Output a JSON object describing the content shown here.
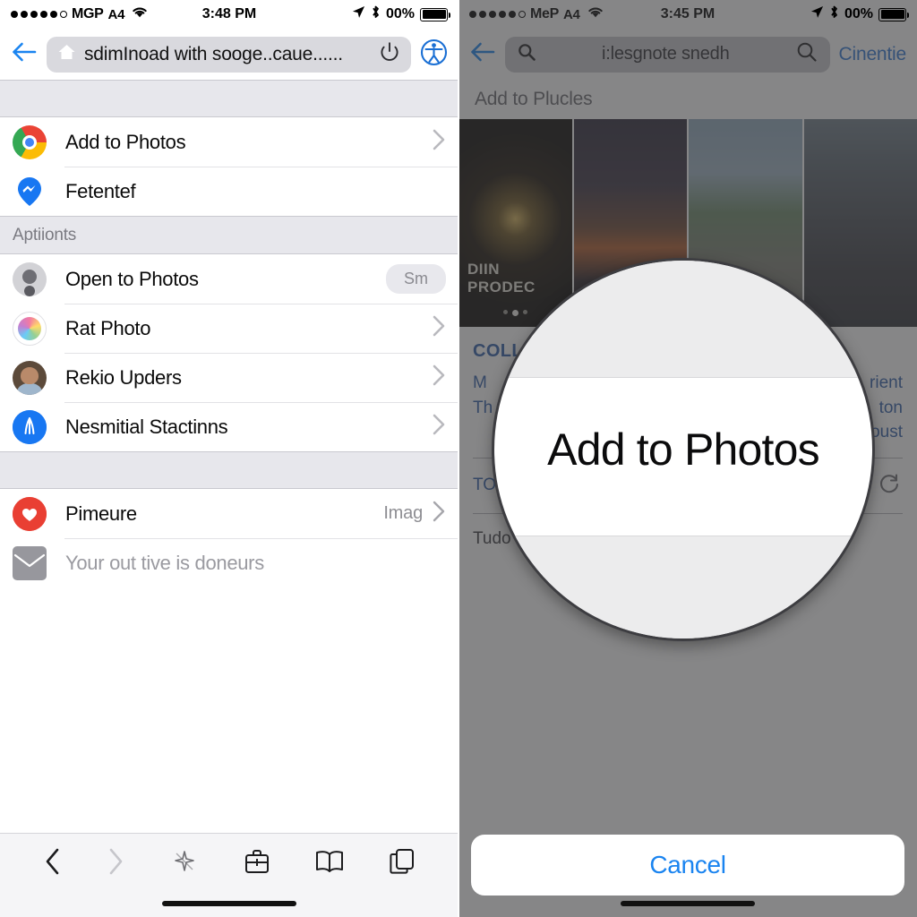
{
  "left": {
    "status": {
      "signal_filled": 5,
      "signal_empty": 1,
      "carrier": "MGP",
      "network": "A4",
      "wifi_icon": "wifi-icon",
      "time": "3:48 PM",
      "location_icon": "location-arrow-icon",
      "bluetooth_icon": "bluetooth-icon",
      "battery_percent": "00%"
    },
    "topbar": {
      "back_icon": "back-arrow-icon",
      "home_icon": "home-icon",
      "url": "sdimInoad with sooge..caue......",
      "reload_icon": "power-reload-icon",
      "extension_icon": "accessibility-icon"
    },
    "sections": [
      {
        "type": "rows",
        "items": [
          {
            "icon": "chrome-icon",
            "label": "Add to Photos",
            "accessory": "chevron"
          },
          {
            "icon": "messenger-pin-icon",
            "label": "Fetentef",
            "accessory": "none"
          }
        ]
      },
      {
        "type": "header",
        "title": "Aptiionts"
      },
      {
        "type": "rows",
        "items": [
          {
            "icon": "person-gray-icon",
            "label": "Open to Photos",
            "accessory": "pill",
            "pill": "Sm"
          },
          {
            "icon": "colorful-ring-icon",
            "label": "Rat Photo",
            "accessory": "chevron"
          },
          {
            "icon": "contact-avatar-icon",
            "label": "Rekio Upders",
            "accessory": "chevron"
          },
          {
            "icon": "blue-circle-icon",
            "label": "Nesmitial Stactinns",
            "accessory": "chevron"
          }
        ]
      },
      {
        "type": "spacer"
      },
      {
        "type": "rows",
        "items": [
          {
            "icon": "heart-red-icon",
            "label": "Pimeure",
            "accessory": "chevron",
            "aux": "Imag"
          },
          {
            "icon": "envelope-gray-icon",
            "label": "Your out tive is doneurs",
            "accessory": "none",
            "muted": true
          }
        ]
      }
    ],
    "toolbar": {
      "back_icon": "chevron-left-icon",
      "forward_icon": "chevron-right-icon",
      "share_icon": "share-sparkle-icon",
      "briefcase_icon": "briefcase-icon",
      "book_icon": "book-icon",
      "tabs_icon": "tabs-icon"
    }
  },
  "right": {
    "status": {
      "signal_filled": 5,
      "signal_empty": 1,
      "carrier": "MeP",
      "network": "A4",
      "wifi_icon": "wifi-icon",
      "time": "3:45 PM",
      "location_icon": "location-arrow-icon",
      "bluetooth_icon": "bluetooth-icon",
      "battery_percent": "00%"
    },
    "topbar": {
      "back_icon": "back-arrow-icon",
      "search_icon": "search-icon",
      "search_value": "i:lesgnote snedh",
      "search_submit_icon": "search-submit-icon",
      "link_label": "Cinentie"
    },
    "section_title": "Add to Plucles",
    "thumbnails": [
      {
        "caption": "DIIN PRODEC",
        "dots": 3,
        "active_dot": 2
      },
      {
        "caption": "",
        "dots": 0,
        "active_dot": 0
      },
      {
        "caption": "",
        "dots": 0,
        "active_dot": 0
      },
      {
        "caption": "",
        "dots": 0,
        "active_dot": 0
      }
    ],
    "body": {
      "heading": "COLL",
      "line1_left": "M",
      "line1_right": "rient",
      "line2_left": "Th",
      "line2_right": "ton",
      "line3_right": "Voust",
      "label_to": "TO",
      "refresh_icon": "refresh-icon",
      "footer": "Tudo"
    },
    "magnifier": {
      "text": "Add to Photos"
    },
    "cancel_label": "Cancel"
  },
  "colors": {
    "accent_blue": "#1a84f0",
    "link_blue": "#2f76d6",
    "text_blue": "#2f5ea8",
    "chrome_red": "#ea4335",
    "heart_red": "#e93f33",
    "pin_blue": "#1877f2"
  }
}
